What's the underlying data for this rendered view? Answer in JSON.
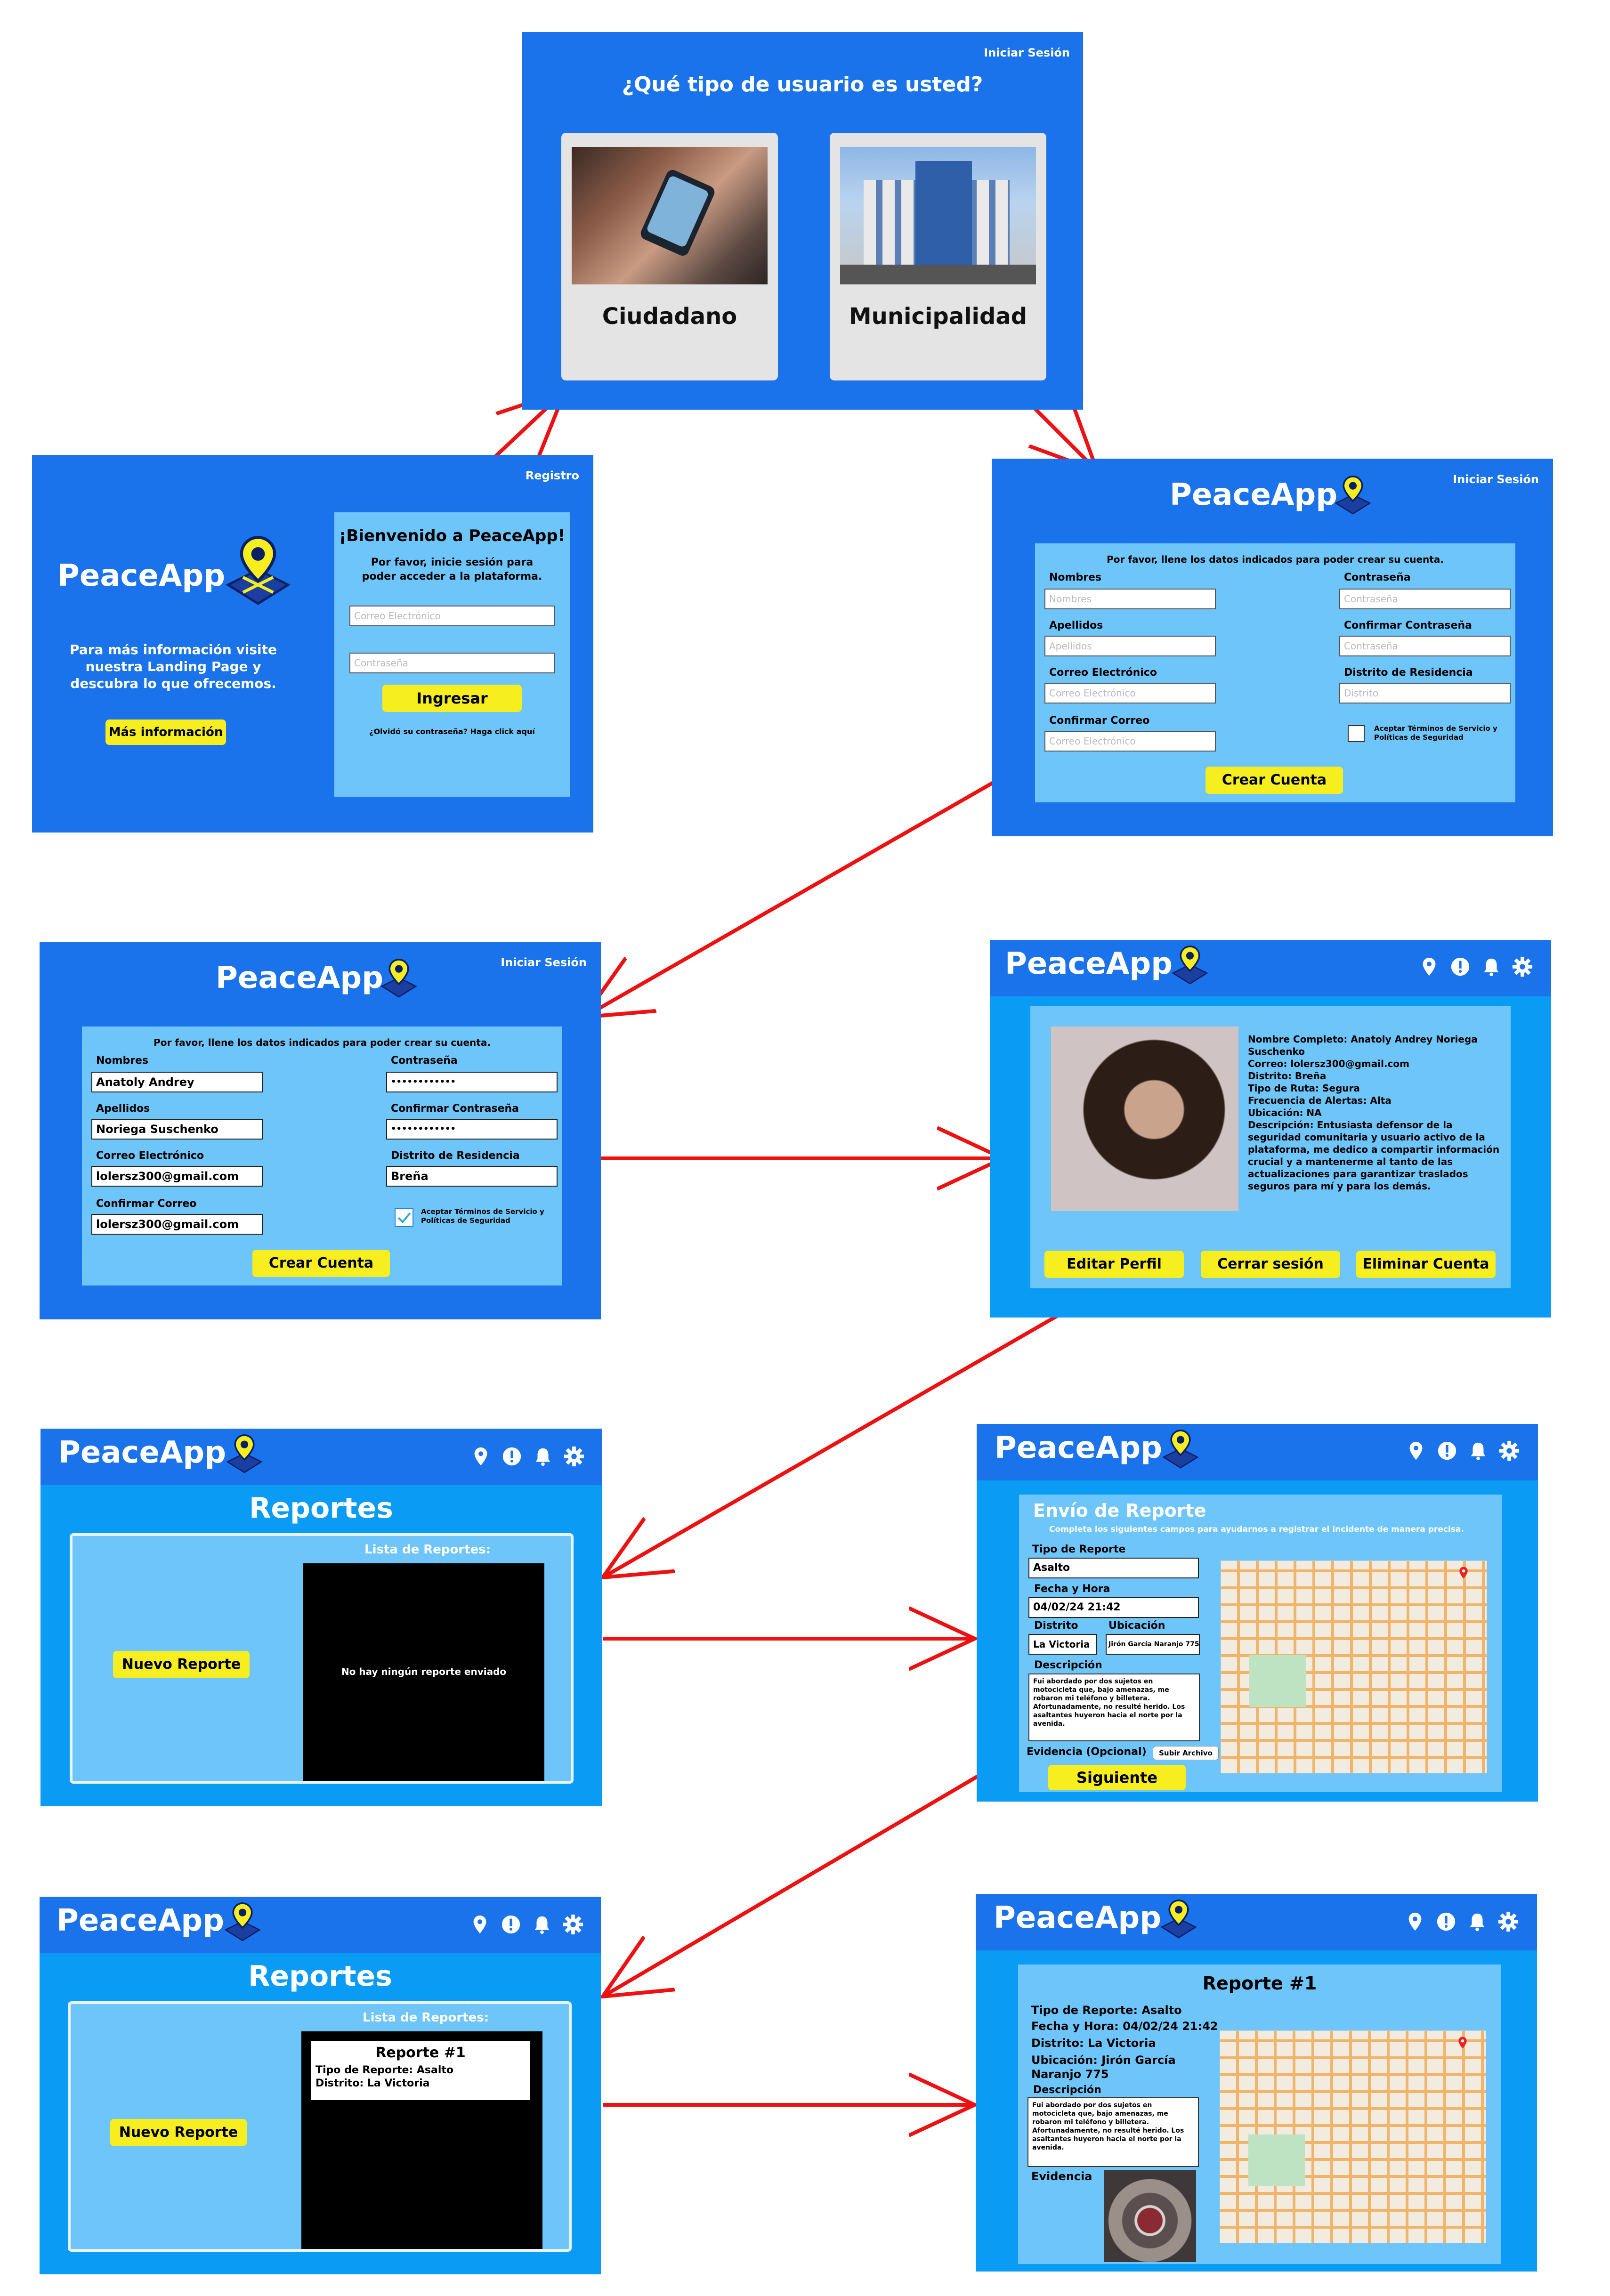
{
  "colors": {
    "primary": "#1a73ea",
    "secondary": "#0a9cf5",
    "panel": "#6ec5fa",
    "button": "#f6ee1e",
    "arrow": "#ee1111"
  },
  "icons": [
    "map-pin-icon",
    "alert-icon",
    "bell-icon",
    "gear-icon"
  ],
  "brand": "PeaceApp",
  "user_type": {
    "login_link": "Iniciar Sesión",
    "question": "¿Qué tipo de usuario es usted?",
    "citizen": "Ciudadano",
    "municipality": "Municipalidad"
  },
  "login": {
    "register_link": "Registro",
    "info": "Para más información visite nuestra Landing Page y descubra lo que ofrecemos.",
    "more_button": "Más información",
    "welcome": "¡Bienvenido a PeaceApp!",
    "instructions": "Por favor, inicie sesión para poder acceder a la plataforma.",
    "email_placeholder": "Correo Electrónico",
    "password_placeholder": "Contraseña",
    "submit": "Ingresar",
    "forgot": "¿Olvidó su contraseña? Haga click aquí"
  },
  "signup": {
    "login_link": "Iniciar Sesión",
    "instructions": "Por favor, llene los datos indicados para poder crear su cuenta.",
    "names_label": "Nombres",
    "names_placeholder": "Nombres",
    "surnames_label": "Apellidos",
    "surnames_placeholder": "Apellidos",
    "email_label": "Correo Electrónico",
    "email_placeholder": "Correo Electrónico",
    "confirm_email_label": "Confirmar Correo",
    "confirm_email_placeholder": "Correo Electrónico",
    "password_label": "Contraseña",
    "password_placeholder": "Contraseña",
    "confirm_password_label": "Confirmar Contraseña",
    "confirm_password_placeholder": "Contraseña",
    "district_label": "Distrito de Residencia",
    "district_placeholder": "Distrito",
    "terms": "Aceptar Términos de Servicio y Políticas de Seguridad",
    "submit": "Crear Cuenta"
  },
  "signup_filled": {
    "names": "Anatoly Andrey",
    "surnames": "Noriega Suschenko",
    "email": "lolersz300@gmail.com",
    "confirm_email": "lolersz300@gmail.com",
    "password": "••••••••••••",
    "confirm_password": "••••••••••••",
    "district": "Breña"
  },
  "profile": {
    "full_name": "Nombre Completo: Anatoly Andrey Noriega Suschenko",
    "email": "Correo: lolersz300@gmail.com",
    "district": "Distrito: Breña",
    "route_type": "Tipo de Ruta: Segura",
    "alert_frequency": "Frecuencia de Alertas: Alta",
    "location": "Ubicación: NA",
    "description": "Descripción: Entusiasta defensor de la seguridad comunitaria y usuario activo de la plataforma, me dedico a compartir información crucial y a mantenerme al tanto de las actualizaciones para garantizar traslados seguros para mí y para los demás.",
    "edit_button": "Editar Perfil",
    "logout_button": "Cerrar sesión",
    "delete_button": "Eliminar Cuenta"
  },
  "reports_empty": {
    "title": "Reportes",
    "list_title": "Lista de Reportes:",
    "new_button": "Nuevo Reporte",
    "empty_message": "No hay ningún reporte enviado"
  },
  "report_form": {
    "title": "Envío de Reporte",
    "subtitle": "Completa los siguientes campos para ayudarnos a registrar el incidente de manera precisa.",
    "type_label": "Tipo de Reporte",
    "type_value": "Asalto",
    "datetime_label": "Fecha y Hora",
    "datetime_value": "04/02/24   21:42",
    "district_label": "Distrito",
    "district_value": "La Victoria",
    "location_label": "Ubicación",
    "location_value": "Jirón García Naranjo 775",
    "description_label": "Descripción",
    "description_value": "Fui abordado por dos sujetos en motocicleta que, bajo amenazas, me robaron mi teléfono y billetera. Afortunadamente, no resulté herido. Los asaltantes huyeron hacia el norte por la avenida.",
    "evidence_label": "Evidencia (Opcional)",
    "upload_button": "Subir Archivo",
    "next_button": "Siguiente"
  },
  "reports_list": {
    "title": "Reportes",
    "list_title": "Lista de Reportes:",
    "new_button": "Nuevo Reporte",
    "card_title": "Reporte #1",
    "card_type": "Tipo de Reporte: Asalto",
    "card_district": "Distrito: La Victoria"
  },
  "report_detail": {
    "title": "Reporte #1",
    "type": "Tipo de Reporte: Asalto",
    "datetime": "Fecha y Hora: 04/02/24   21:42",
    "district": "Distrito: La Victoria",
    "location": "Ubicación: Jirón García Naranjo 775",
    "description_label": "Descripción",
    "description_value": "Fui abordado por dos sujetos en motocicleta que, bajo amenazas, me robaron mi teléfono y billetera. Afortunadamente, no resulté herido. Los asaltantes huyeron hacia el norte por la avenida.",
    "evidence_label": "Evidencia"
  }
}
